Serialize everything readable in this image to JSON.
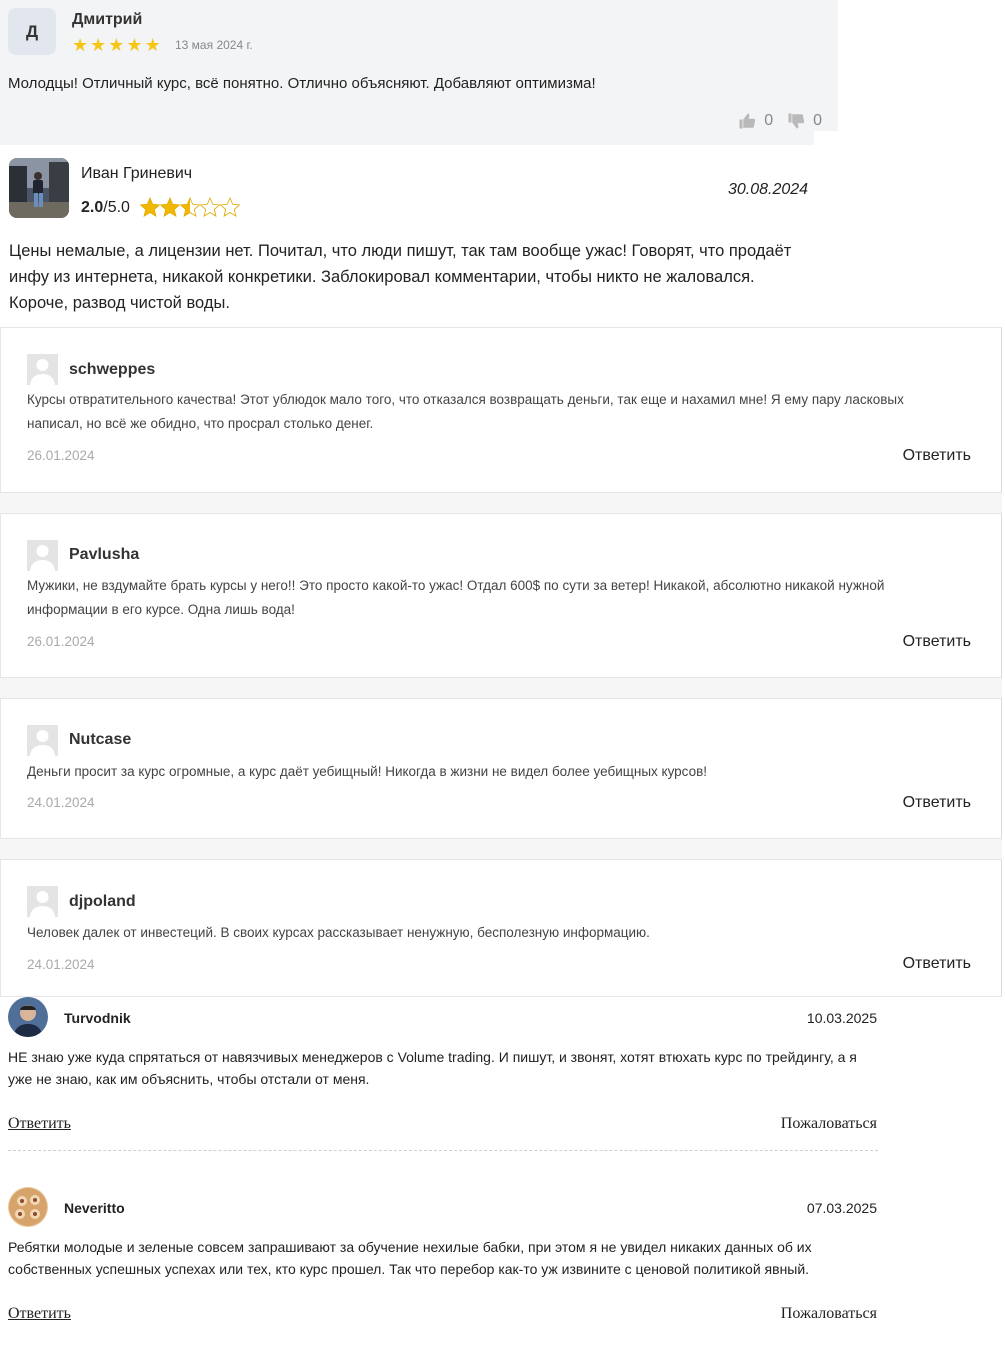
{
  "review_top": {
    "avatar_letter": "Д",
    "name": "Дмитрий",
    "stars": 5,
    "date": "13 мая 2024 г.",
    "text": "Молодцы! Отличный курс, всё понятно. Отлично объясняют. Добавляют оптимизма!",
    "likes": "0",
    "dislikes": "0",
    "star_color": "#f6c518"
  },
  "review_ivan": {
    "name": "Иван Гриневич",
    "rating_value": "2.0",
    "rating_max": "/5.0",
    "stars_filled": 2.5,
    "date": "30.08.2024",
    "text": "Цены немалые, а лицензии нет. Почитал, что люди пишут, так там вообще ужас! Говорят, что продаёт инфу из интернета, никакой конкретики. Заблокировал комментарии, чтобы никто не жаловался. Короче, развод чистой воды."
  },
  "comments": [
    {
      "user": "schweppes",
      "text": "Курсы отвратительного качества! Этот ублюдок мало того, что отказался возвращать деньги, так еще и нахамил мне! Я ему пару ласковых написал, но всё же обидно, что просрал столько денег.",
      "date": "26.01.2024",
      "reply": "Ответить"
    },
    {
      "user": "Pavlusha",
      "text": "Мужики, не вздумайте брать курсы у него!! Это просто какой-то ужас! Отдал 600$ по сути за ветер! Никакой, абсолютно никакой нужной информации в его курсе. Одна лишь вода!",
      "date": "26.01.2024",
      "reply": "Ответить"
    },
    {
      "user": "Nutcase",
      "text": "Деньги просит за курс огромные, а курс даёт уебищный! Никогда в жизни не видел более уебищных курсов!",
      "date": "24.01.2024",
      "reply": "Ответить"
    },
    {
      "user": "djpoland",
      "text": "Человек далек от инвестеций. В своих курсах рассказывает ненужную, бесполезную информацию.",
      "date": "24.01.2024",
      "reply": "Ответить"
    }
  ],
  "user_reviews": [
    {
      "user": "Turvodnik",
      "date": "10.03.2025",
      "text": "НЕ знаю уже куда спрятаться от навязчивых менеджеров с Volume trading. И пишут, и звонят, хотят втюхать курс по трейдингу, а я уже не знаю, как им объяснить, чтобы отстали от меня.",
      "reply": "Ответить",
      "report": "Пожаловаться"
    },
    {
      "user": "Neveritto",
      "date": "07.03.2025",
      "text": "Ребятки молодые и зеленые совсем запрашивают за обучение нехилые бабки, при этом я не увидел никаких данных об их собственных успешных успехах или тех, кто курс прошел. Так что перебор как-то уж извините с ценовой политикой явный.",
      "reply": "Ответить",
      "report": "Пожаловаться"
    }
  ]
}
